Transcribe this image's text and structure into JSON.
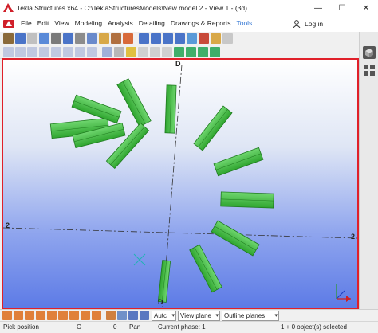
{
  "app": {
    "title": "Tekla Structures x64 - C:\\TeklaStructuresModels\\New model 2  - View 1 - (3d)"
  },
  "window_controls": {
    "minimize": "—",
    "maximize": "☐",
    "close": "✕"
  },
  "menu": {
    "items": [
      "File",
      "Edit",
      "View",
      "Modeling",
      "Analysis",
      "Detailing",
      "Drawings & Reports",
      "Tools"
    ],
    "login_label": "Log in"
  },
  "viewport": {
    "grid_labels": {
      "top": "D",
      "bottom": "D",
      "left": "2",
      "right": "2"
    },
    "colors": {
      "beam": "#3fba3f",
      "beam_edge": "#1e7a1e",
      "frame": "#e0202a"
    }
  },
  "bottom_toolbar": {
    "combo_auto": "Autc",
    "combo_view_plane": "View plane",
    "combo_outline": "Outline planes"
  },
  "status": {
    "pick_position": "Pick position",
    "o_value": "O",
    "zero_value": "0",
    "pan": "Pan",
    "current_phase": "Current phase: 1",
    "selection": "1 + 0 object(s) selected"
  },
  "colors": {
    "accent": "#e0202a",
    "tools_menu": "#3a7bd5"
  }
}
